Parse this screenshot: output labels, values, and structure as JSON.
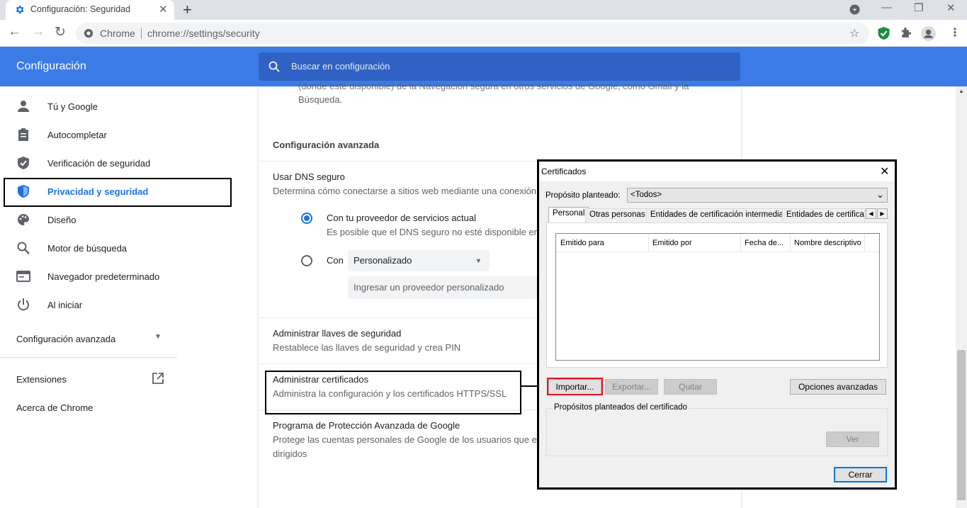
{
  "browser": {
    "tab_title": "Configuración: Seguridad",
    "omnibox_chip": "Chrome",
    "url": "chrome://settings/security"
  },
  "header": {
    "title": "Configuración",
    "search_placeholder": "Buscar en configuración"
  },
  "sidebar": {
    "items": [
      {
        "label": "Tú y Google",
        "icon": "person-icon"
      },
      {
        "label": "Autocompletar",
        "icon": "clipboard-icon"
      },
      {
        "label": "Verificación de seguridad",
        "icon": "shield-check-icon"
      },
      {
        "label": "Privacidad y seguridad",
        "icon": "shield-icon"
      },
      {
        "label": "Diseño",
        "icon": "palette-icon"
      },
      {
        "label": "Motor de búsqueda",
        "icon": "search-icon"
      },
      {
        "label": "Navegador predeterminado",
        "icon": "browser-icon"
      },
      {
        "label": "Al iniciar",
        "icon": "power-icon"
      }
    ],
    "advanced_label": "Configuración avanzada",
    "extensions_label": "Extensiones",
    "about_label": "Acerca de Chrome"
  },
  "main": {
    "top_text_line1": "(donde esté disponible) de la Navegación segura en otros servicios de Google, como Gmail y la",
    "top_text_line2": "Búsqueda.",
    "advanced_heading": "Configuración avanzada",
    "dns_title": "Usar DNS seguro",
    "dns_desc": "Determina cómo conectarse a sitios web mediante una conexión",
    "dns_option1_title": "Con tu proveedor de servicios actual",
    "dns_option1_desc": "Es posible que el DNS seguro no esté disponible en",
    "dns_option2_label": "Con",
    "dns_select_value": "Personalizado",
    "dns_custom_placeholder": "Ingresar un proveedor personalizado",
    "keys_title": "Administrar llaves de seguridad",
    "keys_desc": "Restablece las llaves de seguridad y crea PIN",
    "certs_title": "Administrar certificados",
    "certs_desc": "Administra la configuración y los certificados HTTPS/SSL",
    "protection_title": "Programa de Protección Avanzada de Google",
    "protection_desc_line1": "Protege las cuentas personales de Google de los usuarios que es",
    "protection_desc_line2": "dirigidos"
  },
  "dialog": {
    "title": "Certificados",
    "purpose_label": "Propósito planteado:",
    "purpose_value": "<Todos>",
    "tabs": [
      "Personal",
      "Otras personas",
      "Entidades de certificación intermedias",
      "Entidades de certificaci"
    ],
    "columns": [
      "Emitido para",
      "Emitido por",
      "Fecha de...",
      "Nombre descriptivo"
    ],
    "import_label": "Importar...",
    "export_label": "Exportar...",
    "remove_label": "Quitar",
    "advanced_label": "Opciones avanzadas",
    "purposes_group_label": "Propósitos planteados del certificado",
    "view_label": "Ver",
    "close_label": "Cerrar"
  },
  "colors": {
    "header_blue": "#3b7be6",
    "accent_blue": "#1a73e8",
    "highlight_red": "#e81123"
  }
}
